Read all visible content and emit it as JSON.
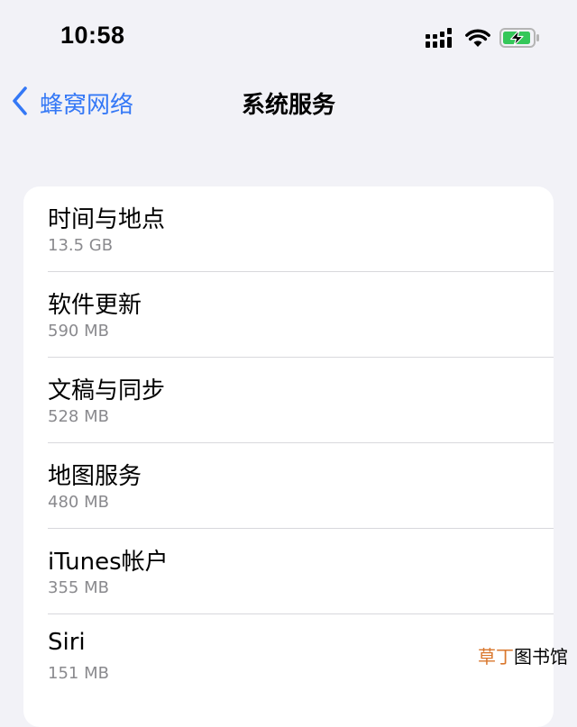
{
  "status_bar": {
    "time": "10:58",
    "icons": [
      "cellular-signal-icon",
      "wifi-icon",
      "battery-charging-icon"
    ]
  },
  "nav": {
    "back_label": "蜂窝网络",
    "title": "系统服务"
  },
  "services": [
    {
      "name": "时间与地点",
      "size": "13.5 GB"
    },
    {
      "name": "软件更新",
      "size": "590 MB"
    },
    {
      "name": "文稿与同步",
      "size": "528 MB"
    },
    {
      "name": "地图服务",
      "size": "480 MB"
    },
    {
      "name": "iTunes帐户",
      "size": "355 MB"
    },
    {
      "name": "Siri",
      "size": "151 MB"
    }
  ],
  "watermark": {
    "accent": "草丁",
    "rest": "图书馆"
  },
  "colors": {
    "accent": "#3478f6",
    "background": "#f2f2f7",
    "battery_charge": "#34c759",
    "secondary_text": "#8a8a8e"
  }
}
